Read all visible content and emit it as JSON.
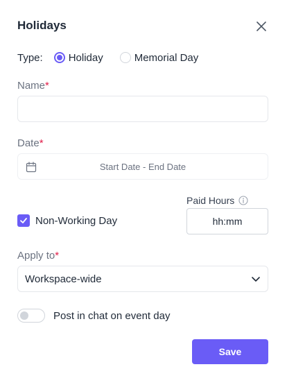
{
  "dialog": {
    "title": "Holidays",
    "close_icon": "close-icon"
  },
  "type": {
    "label": "Type:",
    "options": [
      {
        "label": "Holiday",
        "checked": true
      },
      {
        "label": "Memorial Day",
        "checked": false
      }
    ]
  },
  "name": {
    "label": "Name",
    "required_mark": "*",
    "value": "",
    "placeholder": ""
  },
  "date": {
    "label": "Date",
    "required_mark": "*",
    "placeholder": "Start Date - End Date",
    "icon": "calendar-icon"
  },
  "non_working": {
    "label": "Non-Working Day",
    "checked": true
  },
  "paid_hours": {
    "label": "Paid Hours",
    "placeholder": "hh:mm",
    "value": "",
    "icon": "info-icon"
  },
  "apply_to": {
    "label": "Apply to",
    "required_mark": "*",
    "selected": "Workspace-wide",
    "icon": "chevron-down-icon"
  },
  "post_in_chat": {
    "label": "Post in chat on event day",
    "enabled": false
  },
  "actions": {
    "save_label": "Save"
  },
  "colors": {
    "accent": "#6a5cf6",
    "required": "#e11d48",
    "label": "#6b7280"
  }
}
